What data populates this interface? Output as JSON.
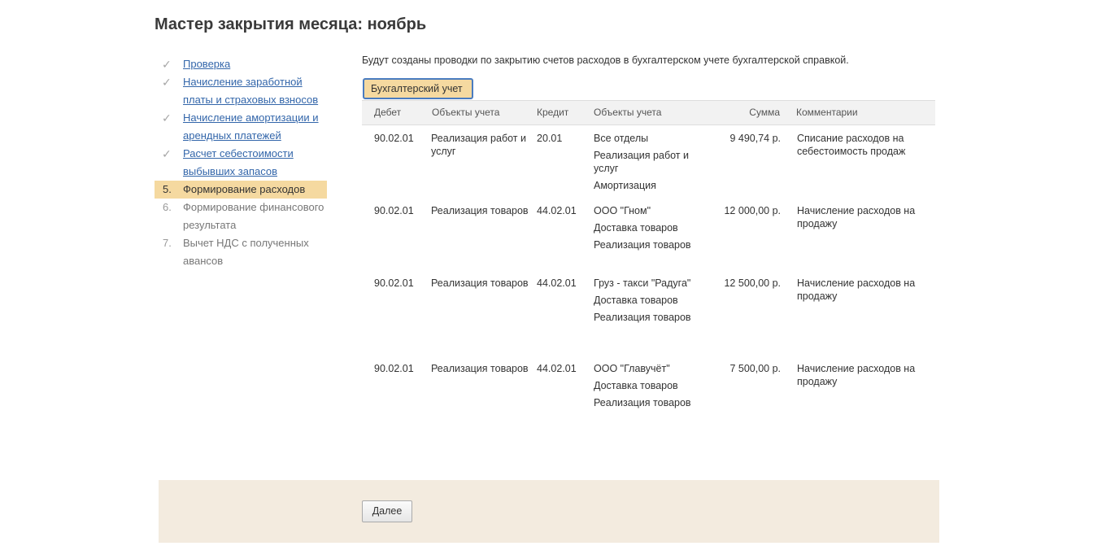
{
  "title": "Мастер закрытия месяца: ноябрь",
  "steps": [
    {
      "marker": "✓",
      "state": "done",
      "lines": [
        "Проверка"
      ]
    },
    {
      "marker": "✓",
      "state": "done",
      "lines": [
        "Начисление заработной",
        "платы и страховых взносов"
      ]
    },
    {
      "marker": "✓",
      "state": "done",
      "lines": [
        "Начисление амортизации и",
        "арендных платежей"
      ]
    },
    {
      "marker": "✓",
      "state": "done",
      "lines": [
        "Расчет себестоимости",
        "выбывших запасов"
      ]
    },
    {
      "marker": "5.",
      "state": "current",
      "lines": [
        "Формирование расходов"
      ]
    },
    {
      "marker": "6.",
      "state": "future",
      "lines": [
        "Формирование финансового",
        "результата"
      ]
    },
    {
      "marker": "7.",
      "state": "future",
      "lines": [
        "Вычет НДС с полученных",
        "авансов"
      ]
    }
  ],
  "intro_text": "Будут созданы проводки по закрытию счетов расходов в бухгалтерском учете бухгалтерской справкой.",
  "tab_label": "Бухгалтерский учет",
  "table": {
    "headers": {
      "debit": "Дебет",
      "objects_debit": "Объекты учета",
      "credit": "Кредит",
      "objects_credit": "Объекты учета",
      "sum": "Сумма",
      "comment": "Комментарии"
    },
    "rows": [
      {
        "debit": "90.02.01",
        "objects_debit": "Реализация работ и услуг",
        "credit": "20.01",
        "objects_credit": [
          "Все отделы",
          "Реализация работ и услуг",
          "Амортизация"
        ],
        "sum": "9 490,74 р.",
        "comment": "Списание расходов на себестоимость продаж"
      },
      {
        "debit": "90.02.01",
        "objects_debit": "Реализация товаров",
        "credit": "44.02.01",
        "objects_credit": [
          "ООО \"Гном\"",
          "Доставка товаров",
          "Реализация товаров"
        ],
        "sum": "12 000,00 р.",
        "comment": "Начисление расходов на продажу"
      },
      {
        "debit": "90.02.01",
        "objects_debit": "Реализация товаров",
        "credit": "44.02.01",
        "objects_credit": [
          "Груз - такси \"Радуга\"",
          "Доставка товаров",
          "Реализация товаров"
        ],
        "sum": "12 500,00 р.",
        "comment": "Начисление расходов на продажу"
      },
      {
        "debit": "90.02.01",
        "objects_debit": "Реализация товаров",
        "credit": "44.02.01",
        "objects_credit": [
          "ООО \"Главучёт\"",
          "Доставка товаров",
          "Реализация товаров"
        ],
        "sum": "7 500,00 р.",
        "comment": "Начисление расходов на продажу"
      }
    ]
  },
  "next_button": "Далее",
  "colors": {
    "current_step_bg": "#f5d9a0",
    "link": "#3366aa",
    "footer_bg": "#f3ebdf",
    "tab_border": "#4a7cc0"
  }
}
